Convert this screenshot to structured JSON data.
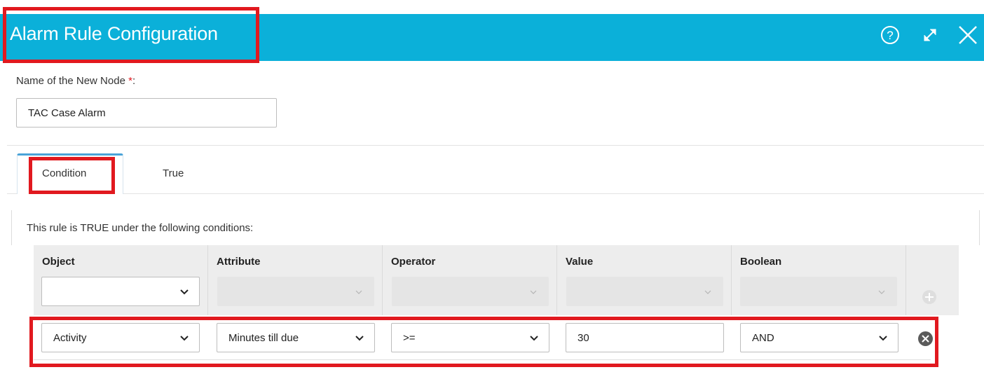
{
  "dialog": {
    "title": "Alarm Rule Configuration",
    "icons": [
      "help-icon",
      "expand-icon",
      "close-icon"
    ]
  },
  "name_field": {
    "label": "Name of the New Node",
    "required_marker": "*",
    "label_suffix": ":",
    "value": "TAC Case Alarm"
  },
  "tabs": [
    {
      "label": "Condition",
      "active": true
    },
    {
      "label": "True",
      "active": false
    }
  ],
  "conditions": {
    "intro": "This rule is TRUE under the following conditions:",
    "columns": [
      "Object",
      "Attribute",
      "Operator",
      "Value",
      "Boolean"
    ],
    "new_row": {
      "object": "",
      "attribute": "",
      "operator": "",
      "value": "",
      "boolean": ""
    },
    "rows": [
      {
        "object": "Activity",
        "attribute": "Minutes till due",
        "operator": ">=",
        "value": "30",
        "boolean": "AND"
      }
    ]
  },
  "colors": {
    "header_bg": "#0bb0d9",
    "highlight": "#e1191f",
    "required": "#e1191f",
    "tab_accent": "#4aa3d8"
  }
}
